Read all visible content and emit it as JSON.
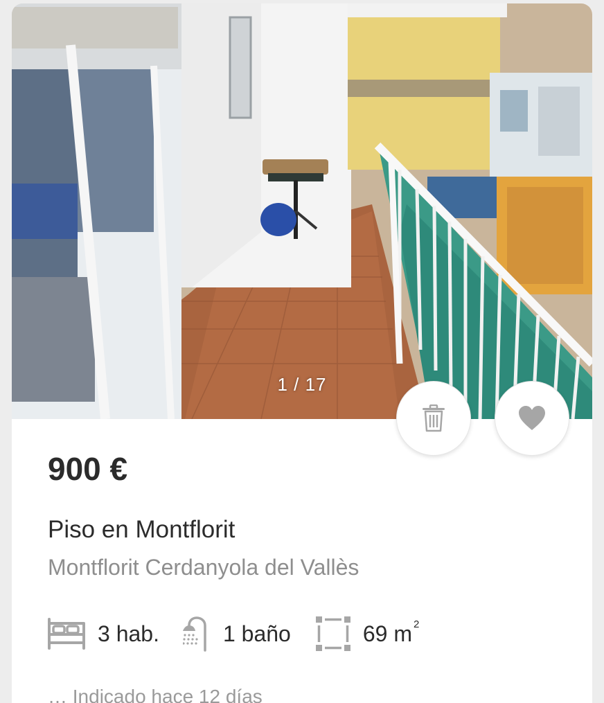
{
  "gallery": {
    "counter": "1 / 17"
  },
  "actions": {
    "discard_icon": "trash-icon",
    "favorite_icon": "heart-icon"
  },
  "listing": {
    "price": "900 €",
    "title": "Piso en Montflorit",
    "location": "Montflorit Cerdanyola del Vallès",
    "features": {
      "rooms": "3 hab.",
      "baths": "1 baño",
      "area": "69 m",
      "area_unit_sup": "2"
    },
    "teaser": "… Indicado hace 12 días"
  },
  "colors": {
    "text_primary": "#2b2b2b",
    "text_secondary": "#8e8e8e",
    "icon_gray": "#a6a6a6"
  }
}
